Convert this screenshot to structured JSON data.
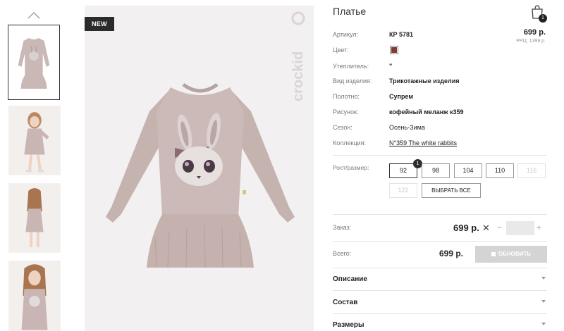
{
  "product": {
    "title": "Платье",
    "badge": "NEW",
    "brand_watermark": "crockid",
    "cart_count": "1",
    "price": "699 р.",
    "rrp": "РРЦ: 1399 р."
  },
  "attributes": [
    {
      "label": "Артикул:",
      "value": "КР 5781"
    },
    {
      "label": "Цвет:",
      "value": ""
    },
    {
      "label": "Утеплитель:",
      "value": "\""
    },
    {
      "label": "Вид изделия:",
      "value": "Трикотажные изделия"
    },
    {
      "label": "Полотно:",
      "value": "Супрем"
    },
    {
      "label": "Рисунок:",
      "value": "кофейный меланж к359"
    },
    {
      "label": "Сезон:",
      "value": "Осень-Зима"
    },
    {
      "label": "Коллекция:",
      "value": "N°359 The white rabbits"
    }
  ],
  "color_swatch": "#7a3f32",
  "sizes": {
    "label": "Рост/размер:",
    "selected_count": "1",
    "options": [
      "92",
      "98",
      "104",
      "110",
      "116",
      "122"
    ],
    "select_all": "ВЫБРАТЬ ВСЕ"
  },
  "order": {
    "label": "Заказ:",
    "price": "699 р.",
    "remove": "✕",
    "minus": "−",
    "plus": "+",
    "qty": ""
  },
  "total": {
    "label": "Всего:",
    "price": "699 р.",
    "update_label": "ОБНОВИТЬ"
  },
  "accordion": [
    "Описание",
    "Состав",
    "Размеры"
  ]
}
